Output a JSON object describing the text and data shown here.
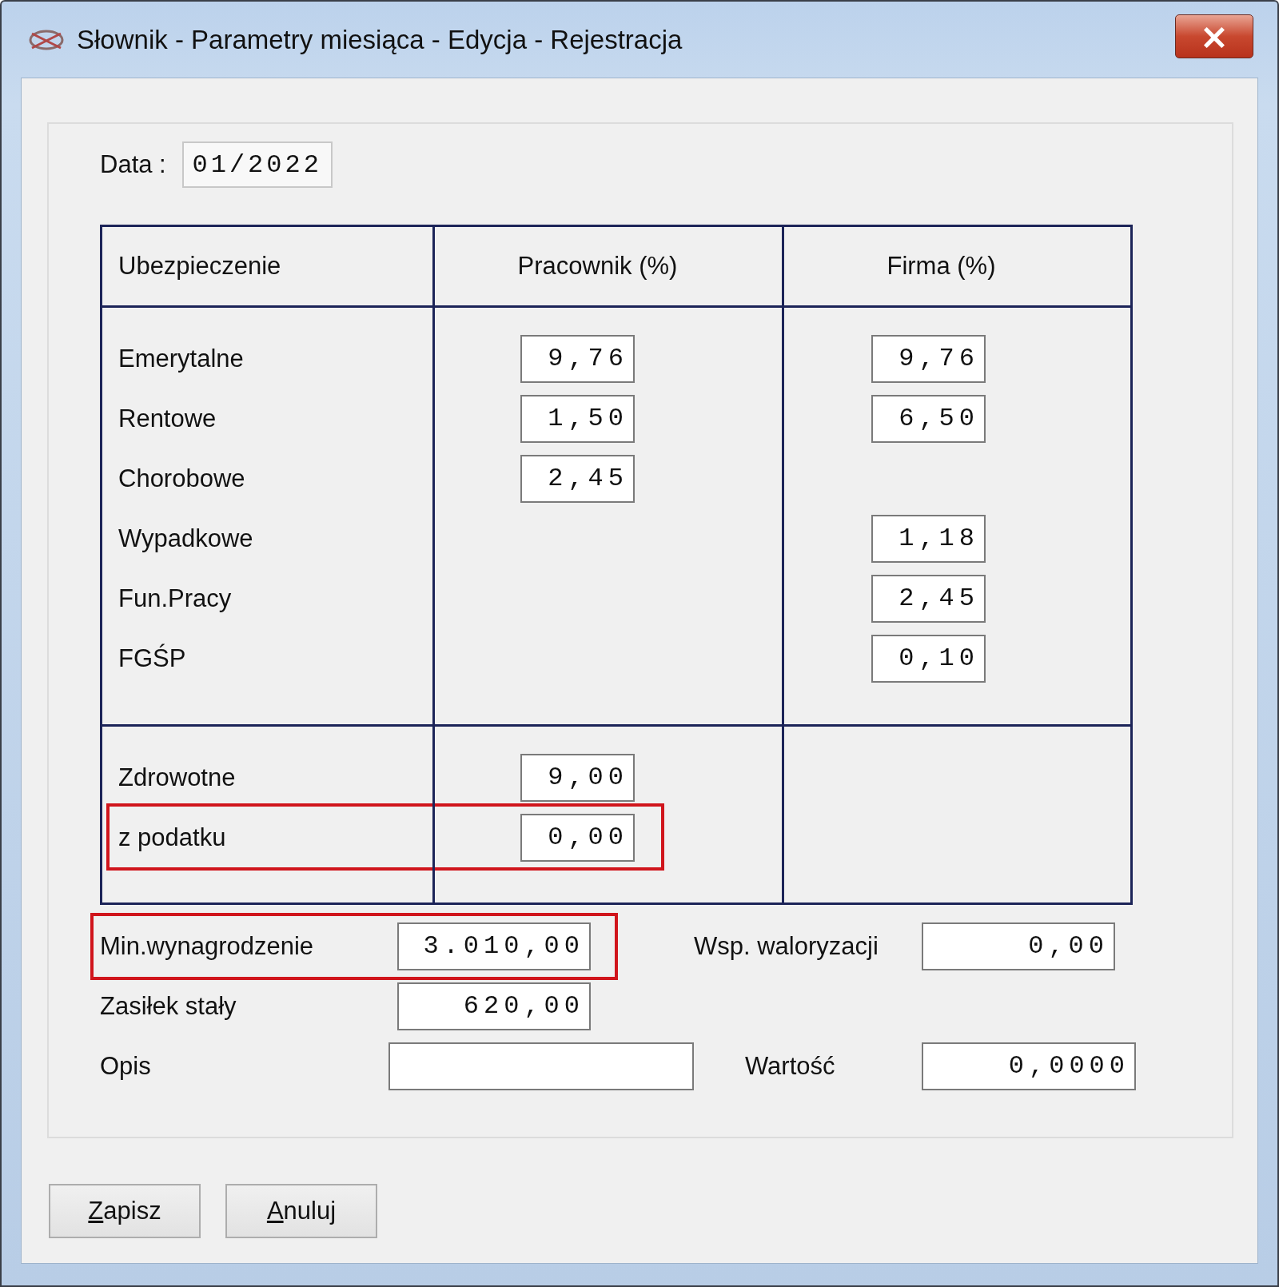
{
  "window": {
    "title": "Słownik - Parametry miesiąca - Edycja - Rejestracja",
    "close": "×"
  },
  "date": {
    "label": "Data :",
    "value": "01/2022"
  },
  "table": {
    "columns": [
      "Ubezpieczenie",
      "Pracownik (%)",
      "Firma (%)"
    ],
    "sections": [
      {
        "rows": [
          {
            "label": "Emerytalne",
            "employee": "9,76",
            "company": "9,76",
            "highlighted": false
          },
          {
            "label": "Rentowe",
            "employee": "1,50",
            "company": "6,50",
            "highlighted": false
          },
          {
            "label": "Chorobowe",
            "employee": "2,45",
            "highlighted": false
          },
          {
            "label": "Wypadkowe",
            "company": "1,18",
            "highlighted": false
          },
          {
            "label": "Fun.Pracy",
            "company": "2,45",
            "highlighted": false
          },
          {
            "label": "FGŚP",
            "company": "0,10",
            "highlighted": false
          }
        ]
      },
      {
        "rows": [
          {
            "label": "Zdrowotne",
            "employee": "9,00",
            "highlighted": false
          },
          {
            "label": "z podatku",
            "employee": "0,00",
            "highlighted": true
          }
        ]
      }
    ]
  },
  "fields": [
    {
      "label": "Min.wynagrodzenie",
      "value": "3.010,00",
      "highlighted": true
    },
    {
      "label": "Wsp. waloryzacji",
      "value": "0,00",
      "highlighted": false
    },
    {
      "label": "Zasiłek stały",
      "value": "620,00",
      "highlighted": false
    },
    {
      "label": "Opis",
      "highlighted": false
    },
    {
      "label": "Wartość",
      "value": "0,0000",
      "highlighted": false
    }
  ],
  "buttons": [
    {
      "label": "Zapisz",
      "underline_first": true
    },
    {
      "label": "Anuluj",
      "underline_first": true
    }
  ]
}
